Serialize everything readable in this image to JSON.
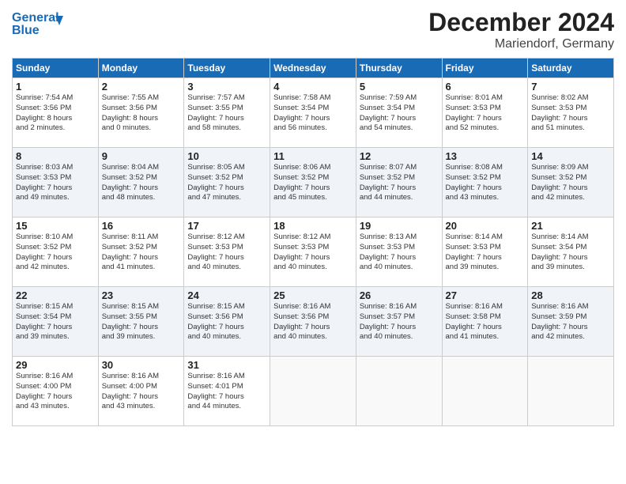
{
  "logo": {
    "line1": "General",
    "line2": "Blue"
  },
  "title": "December 2024",
  "subtitle": "Mariendorf, Germany",
  "days_of_week": [
    "Sunday",
    "Monday",
    "Tuesday",
    "Wednesday",
    "Thursday",
    "Friday",
    "Saturday"
  ],
  "weeks": [
    [
      {
        "day": "1",
        "info": "Sunrise: 7:54 AM\nSunset: 3:56 PM\nDaylight: 8 hours\nand 2 minutes."
      },
      {
        "day": "2",
        "info": "Sunrise: 7:55 AM\nSunset: 3:56 PM\nDaylight: 8 hours\nand 0 minutes."
      },
      {
        "day": "3",
        "info": "Sunrise: 7:57 AM\nSunset: 3:55 PM\nDaylight: 7 hours\nand 58 minutes."
      },
      {
        "day": "4",
        "info": "Sunrise: 7:58 AM\nSunset: 3:54 PM\nDaylight: 7 hours\nand 56 minutes."
      },
      {
        "day": "5",
        "info": "Sunrise: 7:59 AM\nSunset: 3:54 PM\nDaylight: 7 hours\nand 54 minutes."
      },
      {
        "day": "6",
        "info": "Sunrise: 8:01 AM\nSunset: 3:53 PM\nDaylight: 7 hours\nand 52 minutes."
      },
      {
        "day": "7",
        "info": "Sunrise: 8:02 AM\nSunset: 3:53 PM\nDaylight: 7 hours\nand 51 minutes."
      }
    ],
    [
      {
        "day": "8",
        "info": "Sunrise: 8:03 AM\nSunset: 3:53 PM\nDaylight: 7 hours\nand 49 minutes."
      },
      {
        "day": "9",
        "info": "Sunrise: 8:04 AM\nSunset: 3:52 PM\nDaylight: 7 hours\nand 48 minutes."
      },
      {
        "day": "10",
        "info": "Sunrise: 8:05 AM\nSunset: 3:52 PM\nDaylight: 7 hours\nand 47 minutes."
      },
      {
        "day": "11",
        "info": "Sunrise: 8:06 AM\nSunset: 3:52 PM\nDaylight: 7 hours\nand 45 minutes."
      },
      {
        "day": "12",
        "info": "Sunrise: 8:07 AM\nSunset: 3:52 PM\nDaylight: 7 hours\nand 44 minutes."
      },
      {
        "day": "13",
        "info": "Sunrise: 8:08 AM\nSunset: 3:52 PM\nDaylight: 7 hours\nand 43 minutes."
      },
      {
        "day": "14",
        "info": "Sunrise: 8:09 AM\nSunset: 3:52 PM\nDaylight: 7 hours\nand 42 minutes."
      }
    ],
    [
      {
        "day": "15",
        "info": "Sunrise: 8:10 AM\nSunset: 3:52 PM\nDaylight: 7 hours\nand 42 minutes."
      },
      {
        "day": "16",
        "info": "Sunrise: 8:11 AM\nSunset: 3:52 PM\nDaylight: 7 hours\nand 41 minutes."
      },
      {
        "day": "17",
        "info": "Sunrise: 8:12 AM\nSunset: 3:53 PM\nDaylight: 7 hours\nand 40 minutes."
      },
      {
        "day": "18",
        "info": "Sunrise: 8:12 AM\nSunset: 3:53 PM\nDaylight: 7 hours\nand 40 minutes."
      },
      {
        "day": "19",
        "info": "Sunrise: 8:13 AM\nSunset: 3:53 PM\nDaylight: 7 hours\nand 40 minutes."
      },
      {
        "day": "20",
        "info": "Sunrise: 8:14 AM\nSunset: 3:53 PM\nDaylight: 7 hours\nand 39 minutes."
      },
      {
        "day": "21",
        "info": "Sunrise: 8:14 AM\nSunset: 3:54 PM\nDaylight: 7 hours\nand 39 minutes."
      }
    ],
    [
      {
        "day": "22",
        "info": "Sunrise: 8:15 AM\nSunset: 3:54 PM\nDaylight: 7 hours\nand 39 minutes."
      },
      {
        "day": "23",
        "info": "Sunrise: 8:15 AM\nSunset: 3:55 PM\nDaylight: 7 hours\nand 39 minutes."
      },
      {
        "day": "24",
        "info": "Sunrise: 8:15 AM\nSunset: 3:56 PM\nDaylight: 7 hours\nand 40 minutes."
      },
      {
        "day": "25",
        "info": "Sunrise: 8:16 AM\nSunset: 3:56 PM\nDaylight: 7 hours\nand 40 minutes."
      },
      {
        "day": "26",
        "info": "Sunrise: 8:16 AM\nSunset: 3:57 PM\nDaylight: 7 hours\nand 40 minutes."
      },
      {
        "day": "27",
        "info": "Sunrise: 8:16 AM\nSunset: 3:58 PM\nDaylight: 7 hours\nand 41 minutes."
      },
      {
        "day": "28",
        "info": "Sunrise: 8:16 AM\nSunset: 3:59 PM\nDaylight: 7 hours\nand 42 minutes."
      }
    ],
    [
      {
        "day": "29",
        "info": "Sunrise: 8:16 AM\nSunset: 4:00 PM\nDaylight: 7 hours\nand 43 minutes."
      },
      {
        "day": "30",
        "info": "Sunrise: 8:16 AM\nSunset: 4:00 PM\nDaylight: 7 hours\nand 43 minutes."
      },
      {
        "day": "31",
        "info": "Sunrise: 8:16 AM\nSunset: 4:01 PM\nDaylight: 7 hours\nand 44 minutes."
      },
      {
        "day": "",
        "info": ""
      },
      {
        "day": "",
        "info": ""
      },
      {
        "day": "",
        "info": ""
      },
      {
        "day": "",
        "info": ""
      }
    ]
  ]
}
